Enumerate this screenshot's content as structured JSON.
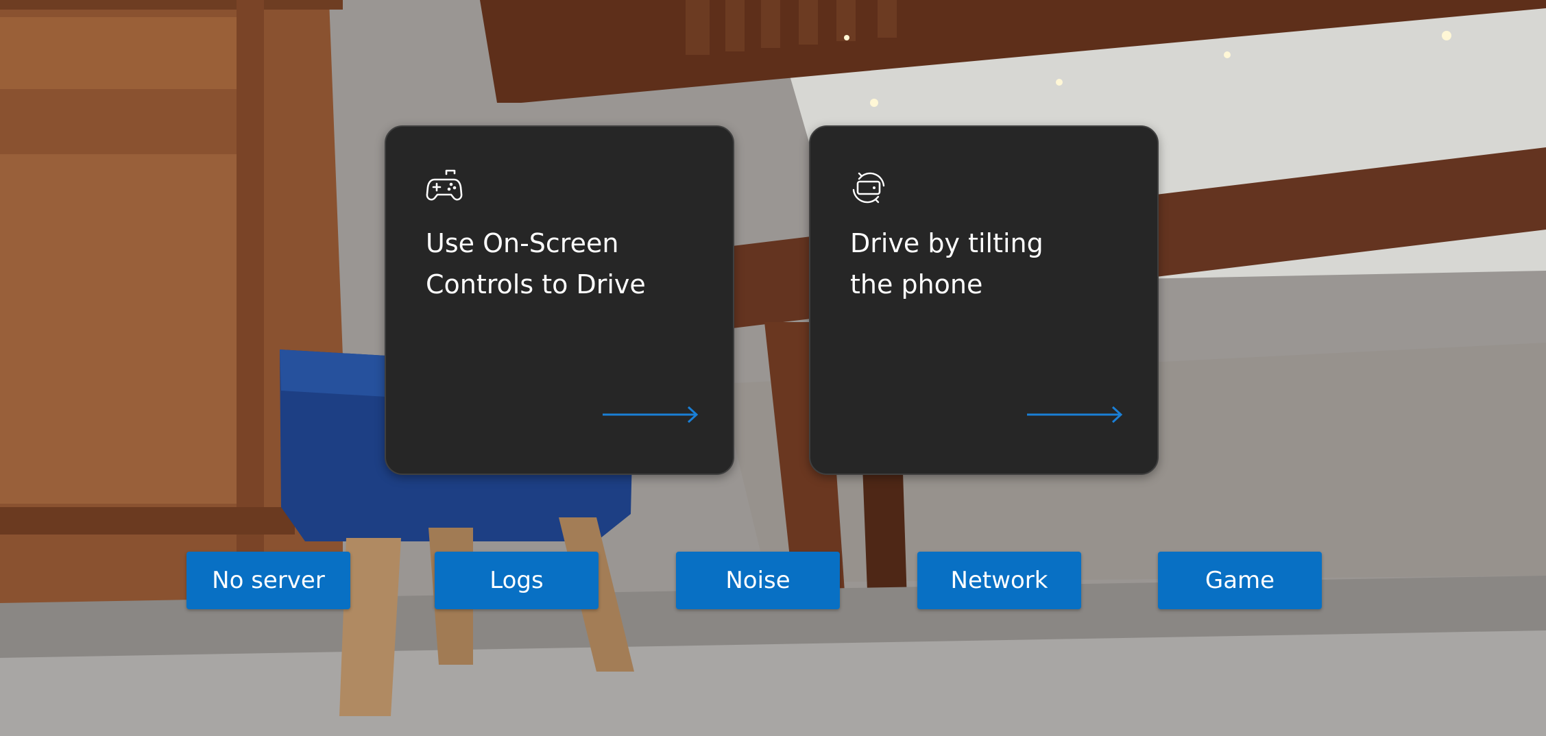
{
  "cards": [
    {
      "icon": "gamepad-icon",
      "title_line1": "Use On-Screen",
      "title_line2": "Controls to Drive",
      "arrow_icon": "arrow-right-icon"
    },
    {
      "icon": "phone-rotate-icon",
      "title_line1": "Drive by tilting",
      "title_line2": "the phone",
      "arrow_icon": "arrow-right-icon"
    }
  ],
  "buttons": {
    "no_server": "No server",
    "logs": "Logs",
    "noise": "Noise",
    "network": "Network",
    "game": "Game"
  },
  "colors": {
    "card_background": "#262626",
    "accent_blue": "#0870c4",
    "arrow_blue": "#1a7fd6",
    "text": "#ffffff"
  }
}
